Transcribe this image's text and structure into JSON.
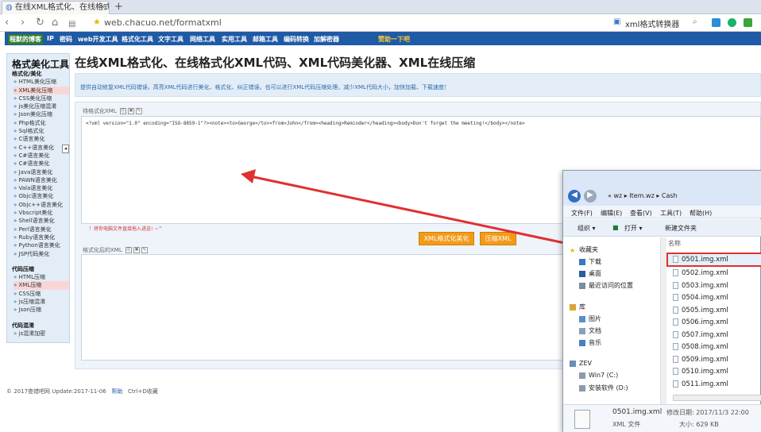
{
  "browser": {
    "tab_title": "在线XML格式化、在线格式化",
    "tab_close": "×",
    "new_tab": "+",
    "nav_back": "‹",
    "nav_forward": "›",
    "nav_reload": "↻",
    "nav_home": "⌂",
    "url": "web.chacuo.net/formatxml",
    "search_box": "xml格式转换器"
  },
  "site_nav": [
    "程默的博客",
    "IP",
    "密码",
    "web开发工具",
    "格式化工具",
    "文字工具",
    "网络工具",
    "实用工具",
    "邮箱工具",
    "编码转换",
    "加解密器",
    "赞助一下吧"
  ],
  "sidebar": {
    "heading": "格式美化工具",
    "section1_title": "格式化/美化",
    "section1_items": [
      "HTML美化压缩",
      "XML美化压缩",
      "CSS美化压缩",
      "js美化压缩混淆",
      "Json美化压缩",
      "Php格式化",
      "Sql格式化",
      "C语言美化",
      "C++语言美化",
      "C#语言美化",
      "C#语言美化",
      "Java语言美化",
      "PAWN语言美化",
      "Vala语言美化",
      "Objc语言美化",
      "Objc++语言美化",
      "Vbscript美化",
      "Shell语言美化",
      "Perl语言美化",
      "Ruby语言美化",
      "Python语言美化",
      "JSP代码美化"
    ],
    "section2_title": "代码压缩",
    "section2_items": [
      "HTML压缩",
      "XML压缩",
      "CSS压缩",
      "js压缩混淆",
      "Json压缩"
    ],
    "section3_title": "代码混淆",
    "section3_items": [
      "js混淆加密"
    ],
    "collapse_glyph": "◂"
  },
  "main": {
    "title": "在线XML格式化、在线格式化XML代码、XML代码美化器、XML在线压缩",
    "description": "提供自动修复XML代码错误，高亮XML代码进行美化、格式化、纠正错误。也可以进行XML代码压缩处理，减少XML代码大小，加快加载、下载速度！",
    "input_label": "待格式化XML",
    "input_content": "<?xml version=\"1.0\" encoding=\"ISO-8859-1\"?><note><to>George</to><from>John</from><heading>Reminder</heading><body>Don't forget the meeting!</body></note>",
    "tip": "！将你电脑文件直接拖入进这! ~^",
    "format_button": "XML格式化美化",
    "compress_button": "压缩XML",
    "output_label": "格式化后的XML",
    "tool_icons": [
      "⎘",
      "✖",
      "✎"
    ]
  },
  "footer": {
    "copyright": "© 2017查错吧网  Update:2017-11-06",
    "help": "帮助",
    "shortcut": "Ctrl+D收藏"
  },
  "explorer": {
    "breadcrumb": "« wz ▸ Item.wz ▸ Cash",
    "back": "◀",
    "forward": "▶",
    "menu": [
      "文件(F)",
      "编辑(E)",
      "查看(V)",
      "工具(T)",
      "帮助(H)"
    ],
    "toolbar": [
      "组织 ▾",
      "打开 ▾",
      "新建文件夹"
    ],
    "nav_items": [
      "收藏夹",
      "下载",
      "桌面",
      "最近访问的位置",
      "库",
      "图片",
      "文档",
      "音乐",
      "ZEV",
      "Win7 (C:)",
      "安装软件 (D:)"
    ],
    "column_header": "名称",
    "files": [
      "0501.img.xml",
      "0502.img.xml",
      "0503.img.xml",
      "0504.img.xml",
      "0505.img.xml",
      "0506.img.xml",
      "0507.img.xml",
      "0508.img.xml",
      "0509.img.xml",
      "0510.img.xml",
      "0511.img.xml"
    ],
    "status_name": "0501.img.xml",
    "status_modified": "修改日期: 2017/11/3 22:00",
    "status_type": "XML 文件",
    "status_size": "大小: 629 KB"
  },
  "colors": {
    "nav_bar": "#1f5aa6",
    "orange_button": "#f29b1a",
    "sidebar_bg": "#e3edf7",
    "arrow": "#e03030"
  }
}
